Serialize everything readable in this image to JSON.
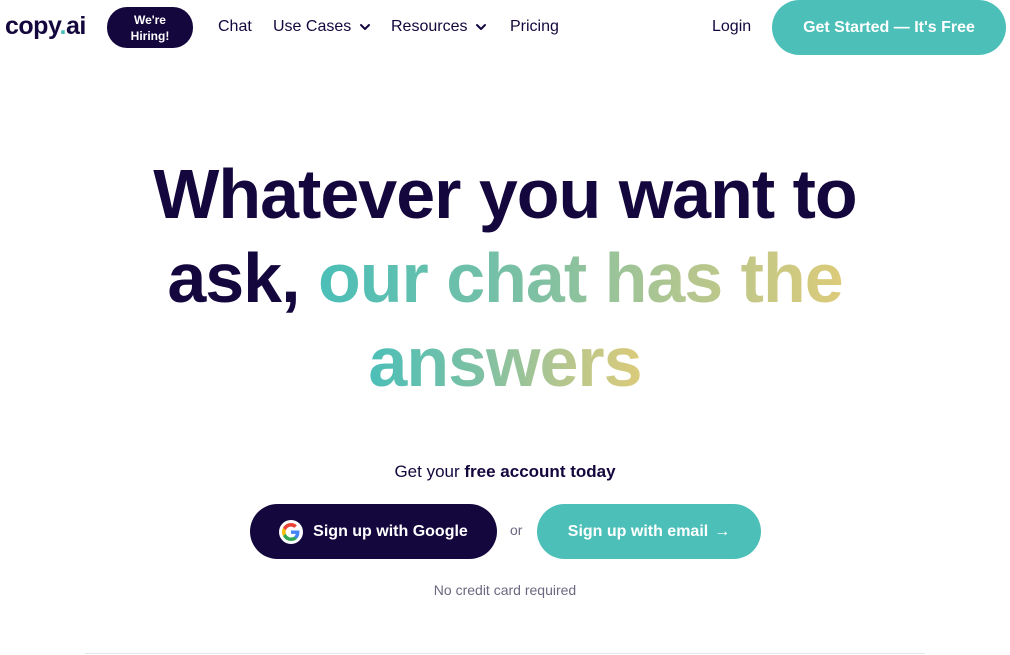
{
  "nav": {
    "logo_main": "copy",
    "logo_dot": ".",
    "logo_suffix": "ai",
    "hiring_badge_line1": "We're",
    "hiring_badge_line2": "Hiring!",
    "links": [
      {
        "label": "Chat"
      },
      {
        "label": "Use Cases"
      },
      {
        "label": "Resources"
      },
      {
        "label": "Pricing"
      }
    ],
    "login_label": "Login",
    "cta_label": "Get Started — It's Free"
  },
  "hero": {
    "headline_dark_1": "Whatever you want to",
    "headline_dark_2": "ask,",
    "headline_gradient_1": "our chat has the",
    "headline_gradient_2": "answers",
    "subline_prefix": "Get your",
    "subline_bold": "free account today",
    "google_button_label": "Sign up with Google",
    "or_label": "or",
    "email_button_label": "Sign up with email",
    "email_arrow": "→",
    "note": "No credit card required"
  },
  "colors": {
    "brand_dark": "#14073d",
    "brand_teal": "#4bbfb8",
    "gradient_end": "#dccb7a"
  }
}
